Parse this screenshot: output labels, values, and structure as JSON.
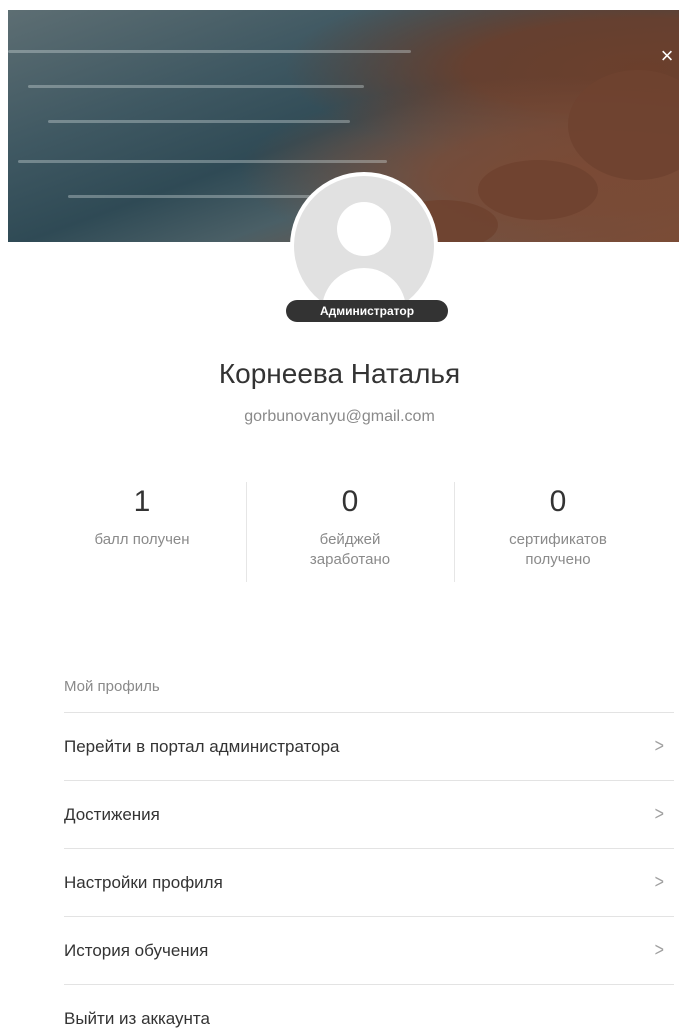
{
  "header": {
    "close_icon": "close-icon",
    "close_glyph": "×"
  },
  "profile": {
    "role_badge": "Администратор",
    "name": "Корнеева Наталья",
    "email": "gorbunovanyu@gmail.com"
  },
  "stats": [
    {
      "value": "1",
      "label_line1": "балл получен",
      "label_line2": ""
    },
    {
      "value": "0",
      "label_line1": "бейджей",
      "label_line2": "заработано"
    },
    {
      "value": "0",
      "label_line1": "сертификатов",
      "label_line2": "получено"
    }
  ],
  "menu": {
    "header": "Мой профиль",
    "items": [
      {
        "label": "Перейти в портал администратора",
        "icon": "chevron-right-icon"
      },
      {
        "label": "Достижения",
        "icon": "chevron-right-icon"
      },
      {
        "label": "Настройки профиля",
        "icon": "chevron-right-icon"
      },
      {
        "label": "История обучения",
        "icon": "chevron-right-icon"
      },
      {
        "label": "Выйти из аккаунта"
      }
    ],
    "chevron_glyph": ">"
  },
  "colors": {
    "badge_bg": "#333333",
    "text_primary": "#333333",
    "text_secondary": "#8a8a8a",
    "divider": "#e3e3e3"
  }
}
